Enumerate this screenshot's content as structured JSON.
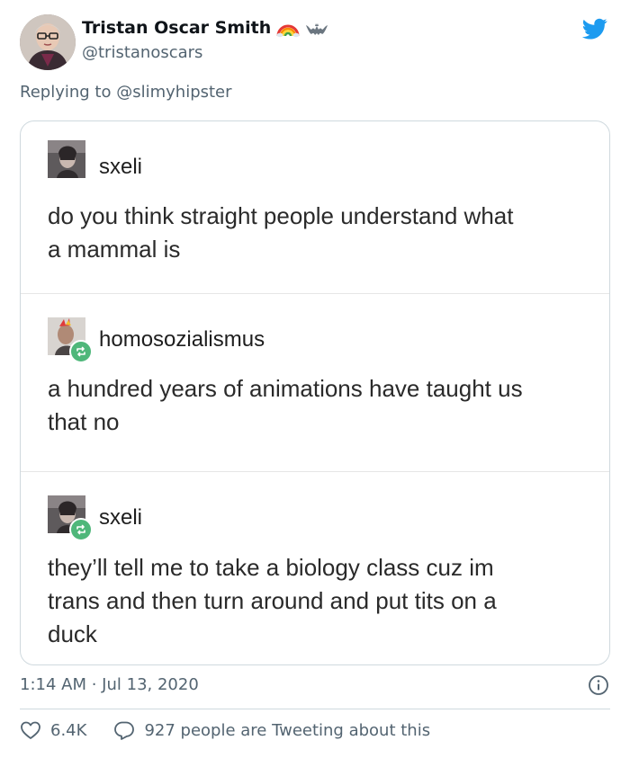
{
  "author": {
    "display_name": "Tristan Oscar Smith",
    "handle": "@tristanoscars"
  },
  "reply": {
    "prefix": "Replying to",
    "mention": "@slimyhipster"
  },
  "embedded_posts": [
    {
      "username": "sxeli",
      "lines": [
        "do you think straight people understand what",
        "a mammal is"
      ],
      "reblog": false
    },
    {
      "username": "homosozialismus",
      "lines": [
        "a hundred years of animations have taught us",
        "that no"
      ],
      "reblog": true
    },
    {
      "username": "sxeli",
      "lines": [
        "they’ll tell me to take a biology class cuz im",
        "trans and then turn around and put tits on a",
        "duck"
      ],
      "reblog": true
    }
  ],
  "meta": {
    "time": "1:14 AM",
    "separator": " · ",
    "date": "Jul 13, 2020"
  },
  "actions": {
    "likes": "6.4K",
    "conversation": "927 people are Tweeting about this"
  },
  "colors": {
    "twitter_blue": "#1d9bf0",
    "reblog_green": "#4fb77a",
    "muted_text": "#536471"
  },
  "icons": [
    "twitter-bird-icon",
    "rainbow-emoji",
    "bat-emoji",
    "reblog-icon",
    "info-icon",
    "heart-icon",
    "speech-bubble-icon"
  ]
}
